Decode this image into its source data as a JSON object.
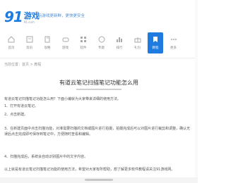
{
  "header": {
    "logo_number": "91",
    "logo_text": "游戏",
    "logo_subtext": "91.com",
    "slogan": "玩游戏更新鲜，更快更安全"
  },
  "nav": {
    "items": [
      {
        "label": "首页",
        "icon": "home-icon"
      },
      {
        "label": "资讯",
        "icon": "news-icon"
      },
      {
        "label": "攻略",
        "icon": "guide-icon"
      },
      {
        "label": "游戏",
        "icon": "game-icon"
      },
      {
        "label": "软件",
        "icon": "app-icon"
      },
      {
        "label": "专题",
        "icon": "topic-icon"
      },
      {
        "label": "排行",
        "icon": "rank-icon"
      },
      {
        "label": "礼包",
        "icon": "gift-icon"
      },
      {
        "label": "教程",
        "icon": "tutorial-icon"
      },
      {
        "label": "更多",
        "icon": "more-icon"
      }
    ],
    "active_index": 8,
    "accent": "#1e7be0"
  },
  "breadcrumb": "当前位置：首页 > 教程",
  "article": {
    "title": "有道云笔记扫描笔记功能怎么用",
    "paragraphs": [
      "有道云笔记扫描笔记功能怎么用？下面小编就为大家带来详细的使用方法。",
      "1、打开有道云笔记。",
      "2、点击新建。",
      "3、在新建页面中点击扫描功能，对准需要扫描的文档或图片进行拍摄，拍摄完成后可以对图片进行裁剪和调整，确认无误后点击完成即可保存到笔记中，方便随时查看和编辑。",
      "4、扫描完成后，系统会自动识别图片中的文字内容。",
      "以上就是有道云笔记扫描笔记功能的使用方法，希望对大家有所帮助，想了解更多软件教程请关注91游戏网。"
    ]
  }
}
